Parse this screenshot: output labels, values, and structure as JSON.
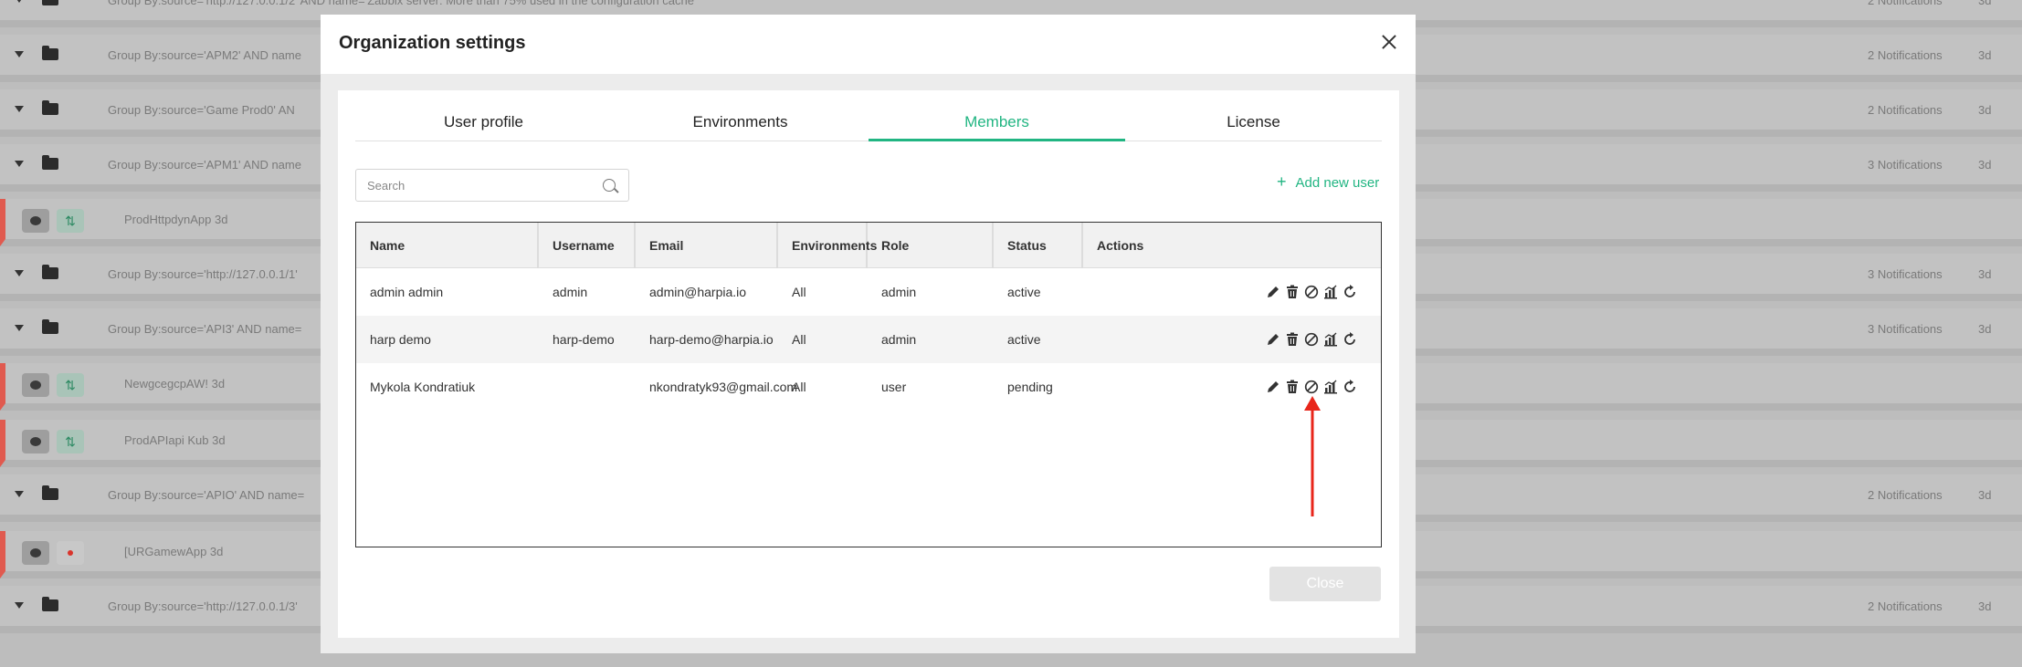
{
  "background": {
    "rows": [
      {
        "type": "group",
        "text": "Group By:source='http://127.0.0.1/2' AND name='Zabbix server: More than 75% used in the configuration cache'",
        "notifications": "2 Notifications",
        "age": "3d"
      },
      {
        "type": "group",
        "text": "Group By:source='APM2' AND name",
        "notifications": "2 Notifications",
        "age": "3d"
      },
      {
        "type": "group",
        "text": "Group By:source='Game Prod0' AN",
        "notifications": "2 Notifications",
        "age": "3d"
      },
      {
        "type": "group",
        "text": "Group By:source='APM1' AND name",
        "notifications": "3 Notifications",
        "age": "3d"
      },
      {
        "type": "app",
        "text": "ProdHttpdynApp  3d"
      },
      {
        "type": "group",
        "text": "Group By:source='http://127.0.0.1/1'",
        "notifications": "3 Notifications",
        "age": "3d"
      },
      {
        "type": "group",
        "text": "Group By:source='API3' AND name=",
        "notifications": "3 Notifications",
        "age": "3d"
      },
      {
        "type": "app",
        "text": "NewgcegcpAW!  3d"
      },
      {
        "type": "app",
        "text": "ProdAPIapi Kub  3d"
      },
      {
        "type": "group",
        "text": "Group By:source='APIO' AND name=",
        "notifications": "2 Notifications",
        "age": "3d"
      },
      {
        "type": "app-red",
        "text": "[URGamewApp  3d"
      },
      {
        "type": "group",
        "text": "Group By:source='http://127.0.0.1/3'",
        "notifications": "2 Notifications",
        "age": "3d"
      }
    ]
  },
  "modal": {
    "title": "Organization settings",
    "tabs": [
      "User profile",
      "Environments",
      "Members",
      "License"
    ],
    "active_tab": "Members",
    "search": {
      "placeholder": "Search",
      "value": ""
    },
    "add_user_label": "Add new user",
    "table": {
      "headers": [
        "Name",
        "Username",
        "Email",
        "Environments",
        "Role",
        "Status",
        "Actions"
      ],
      "rows": [
        {
          "name": "admin admin",
          "username": "admin",
          "email": "admin@harpia.io",
          "environments": "All",
          "role": "admin",
          "status": "active"
        },
        {
          "name": "harp demo",
          "username": "harp-demo",
          "email": "harp-demo@harpia.io",
          "environments": "All",
          "role": "admin",
          "status": "active"
        },
        {
          "name": "Mykola Kondratiuk",
          "username": "",
          "email": "nkondratyk93@gmail.com",
          "environments": "All",
          "role": "user",
          "status": "pending"
        }
      ],
      "action_icons": [
        "pencil-icon",
        "trash-icon",
        "block-icon",
        "chart-icon",
        "refresh-icon"
      ]
    },
    "close_label": "Close"
  },
  "colors": {
    "accent": "#21b582",
    "annotation_arrow": "#e8261b"
  }
}
